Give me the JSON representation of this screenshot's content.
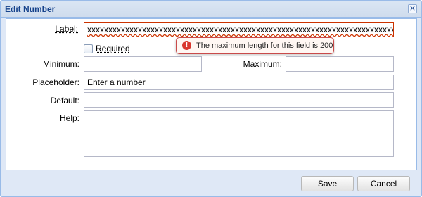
{
  "window": {
    "title": "Edit Number",
    "close_symbol": "×"
  },
  "form": {
    "label": {
      "label": "Label:",
      "value": "xxxxxxxxxxxxxxxxxxxxxxxxxxxxxxxxxxxxxxxxxxxxxxxxxxxxxxxxxxxxxxxxxxxxxxxxxxxxxxxc"
    },
    "required": {
      "label": "Required",
      "checked": false
    },
    "minimum": {
      "label": "Minimum:",
      "value": ""
    },
    "maximum": {
      "label": "Maximum:",
      "value": ""
    },
    "placeholder": {
      "label": "Placeholder:",
      "value": "Enter a number"
    },
    "default": {
      "label": "Default:",
      "value": ""
    },
    "help": {
      "label": "Help:",
      "value": ""
    }
  },
  "error_tooltip": {
    "icon": "error-icon",
    "icon_glyph": "!",
    "text": "The maximum length for this field is 200"
  },
  "buttons": {
    "save": "Save",
    "cancel": "Cancel"
  },
  "colors": {
    "title": "#15428b",
    "border": "#99bbe8",
    "background": "#dfe8f6",
    "error": "#cc3300"
  }
}
